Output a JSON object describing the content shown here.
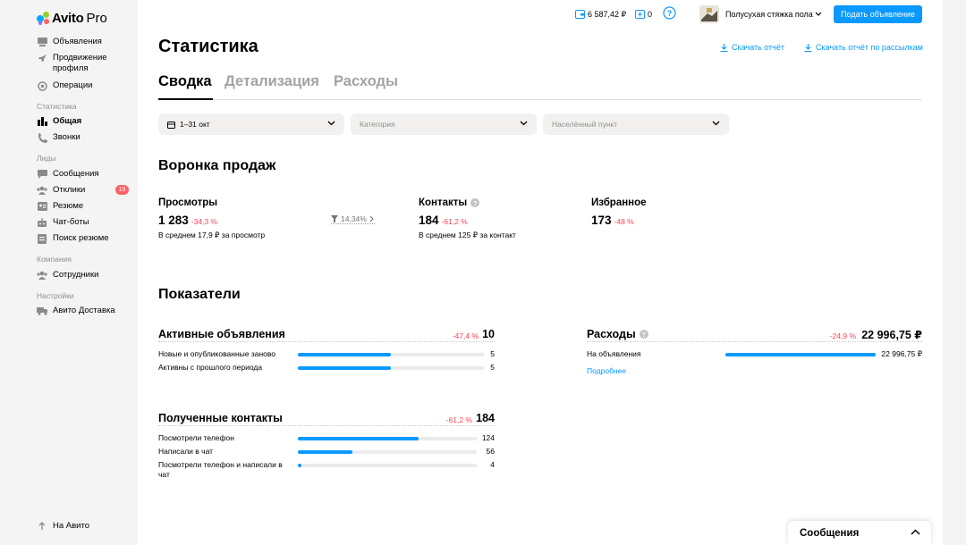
{
  "app": {
    "logo_text": "Avito",
    "logo_pro": "Pro"
  },
  "sidebar": {
    "items_main": [
      {
        "label": "Объявления",
        "icon": "listings-icon"
      },
      {
        "label": "Продвижение профиля",
        "icon": "rocket-icon"
      },
      {
        "label": "Операции",
        "icon": "operations-icon"
      }
    ],
    "section_stats": "Статистика",
    "items_stats": [
      {
        "label": "Общая",
        "icon": "bar-chart-icon",
        "active": true
      },
      {
        "label": "Звонки",
        "icon": "phone-icon"
      }
    ],
    "section_leads": "Лиды",
    "items_leads": [
      {
        "label": "Сообщения",
        "icon": "chat-icon"
      },
      {
        "label": "Отклики",
        "icon": "people-icon",
        "badge": "19"
      },
      {
        "label": "Резюме",
        "icon": "resume-icon"
      },
      {
        "label": "Чат-боты",
        "icon": "bot-icon"
      },
      {
        "label": "Поиск резюме",
        "icon": "search-resume-icon"
      }
    ],
    "section_company": "Компания",
    "items_company": [
      {
        "label": "Сотрудники",
        "icon": "people-icon"
      }
    ],
    "section_settings": "Настройки",
    "items_settings": [
      {
        "label": "Авито Доставка",
        "icon": "truck-icon"
      }
    ],
    "footer_link": "На Авито"
  },
  "topbar": {
    "wallet": "6 587,42 ₽",
    "bonus": "0",
    "profile_name": "Полусухая стяжка пола",
    "post_button": "Подать объявление"
  },
  "page": {
    "title": "Статистика",
    "download_report": "Скачать отчёт",
    "download_mailing_report": "Скачать отчёт по рассылкам"
  },
  "tabs": [
    "Сводка",
    "Детализация",
    "Расходы"
  ],
  "filters": {
    "period": "1–31 окт",
    "category_placeholder": "Категория",
    "city_placeholder": "Населённый пункт"
  },
  "funnel": {
    "title": "Воронка продаж",
    "views": {
      "title": "Просмотры",
      "value": "1 283",
      "delta": "-34,3 %",
      "sub": "В среднем 17,9 ₽ за просмотр"
    },
    "conversion": "14,34%",
    "contacts": {
      "title": "Контакты",
      "value": "184",
      "delta": "-61,2 %",
      "sub": "В среднем 125 ₽ за контакт"
    },
    "favorites": {
      "title": "Избранное",
      "value": "173",
      "delta": "-48 %"
    }
  },
  "kpi": {
    "title": "Показатели",
    "active_ads": {
      "title": "Активные объявления",
      "delta": "-47,4 %",
      "value": "10",
      "rows": [
        {
          "label": "Новые и опубликованные заново",
          "value": "5",
          "fill": 0.5
        },
        {
          "label": "Активны с прошлого периода",
          "value": "5",
          "fill": 0.5
        }
      ]
    },
    "expenses": {
      "title": "Расходы",
      "delta": "-24,9 %",
      "value": "22 996,75 ₽",
      "rows": [
        {
          "label": "На объявления",
          "value": "22 996,75 ₽",
          "fill": 1.0
        }
      ],
      "more": "Подробнее"
    },
    "contacts": {
      "title": "Полученные контакты",
      "delta": "-61,2 %",
      "value": "184",
      "rows": [
        {
          "label": "Посмотрели телефон",
          "value": "124",
          "fill": 0.674
        },
        {
          "label": "Написали в чат",
          "value": "56",
          "fill": 0.304
        },
        {
          "label": "Посмотрели телефон и написали в чат",
          "value": "4",
          "fill": 0.022
        }
      ]
    }
  },
  "messages_panel": {
    "title": "Сообщения"
  },
  "colors": {
    "accent": "#0a99ff",
    "negative": "#ff4053",
    "badge": "#ff6163"
  }
}
